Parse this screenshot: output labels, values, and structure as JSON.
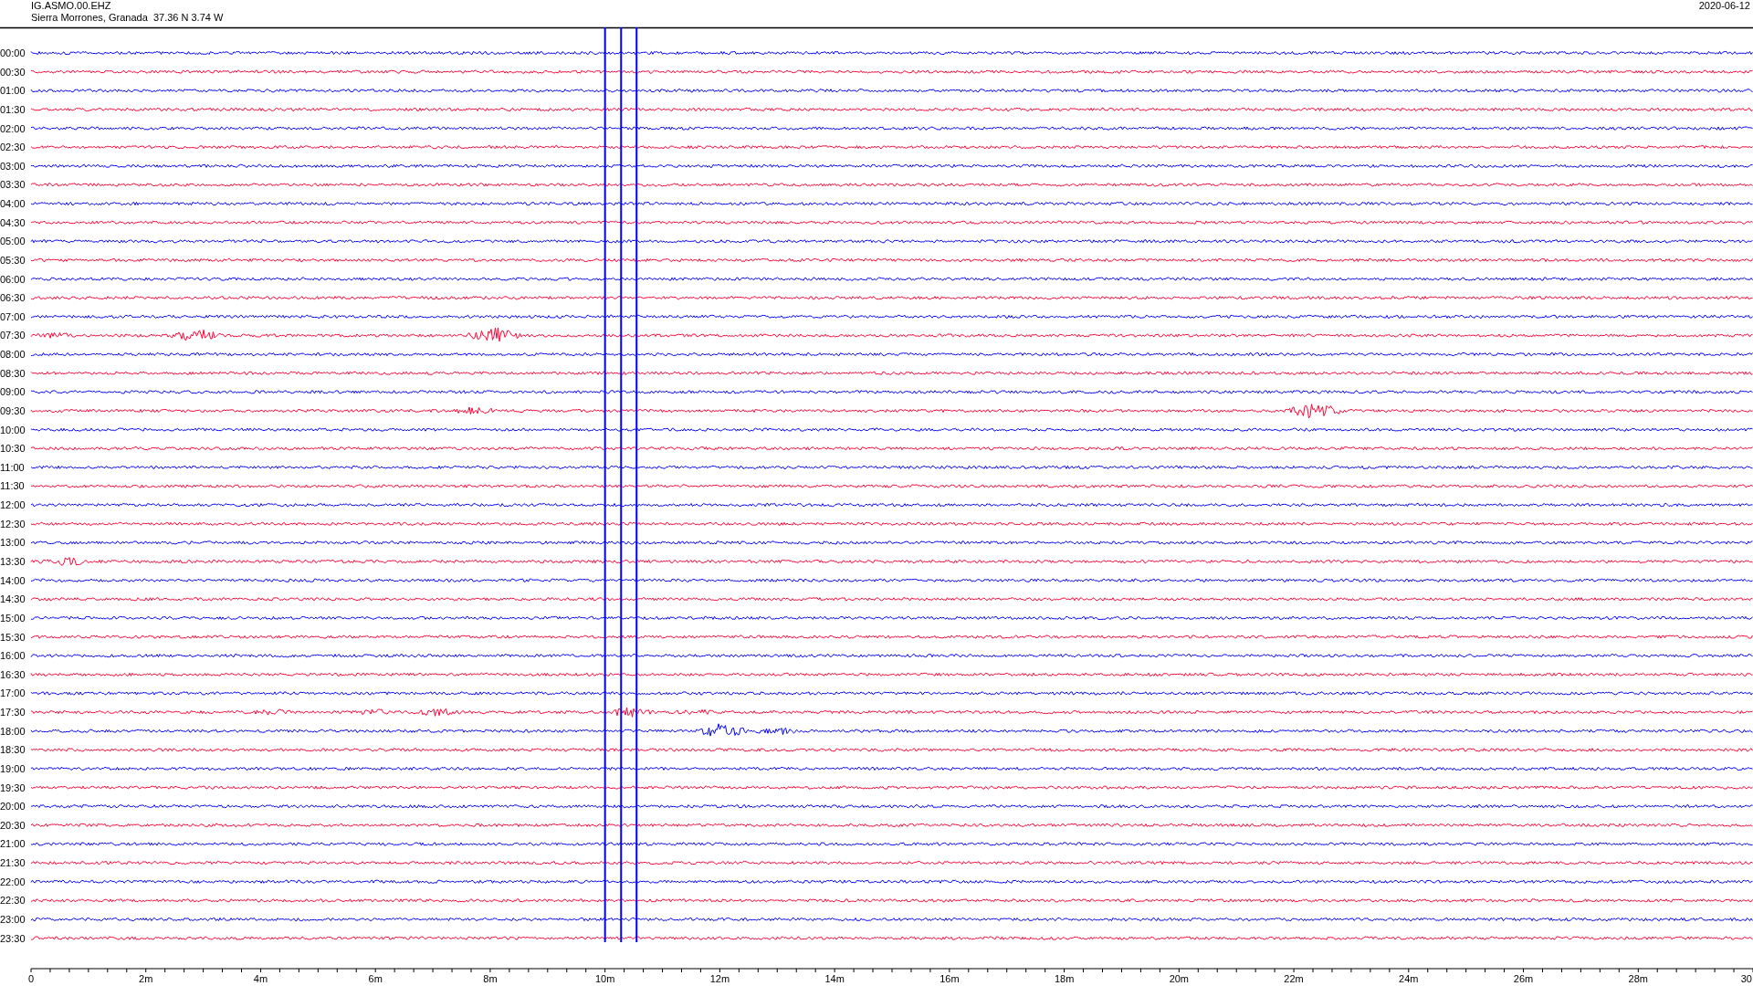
{
  "header": {
    "station": "IG.ASMO.00.EHZ",
    "location": "Sierra Morrones, Granada  37.36 N 3.74 W",
    "date": "2020-06-12"
  },
  "traces": [
    {
      "time": "00:00",
      "color": "#0000ff"
    },
    {
      "time": "00:30",
      "color": "#ff0033"
    },
    {
      "time": "01:00",
      "color": "#0000ff"
    },
    {
      "time": "01:30",
      "color": "#ff0033"
    },
    {
      "time": "02:00",
      "color": "#0000ff"
    },
    {
      "time": "02:30",
      "color": "#ff0033"
    },
    {
      "time": "03:00",
      "color": "#0000ff"
    },
    {
      "time": "03:30",
      "color": "#ff0033"
    },
    {
      "time": "04:00",
      "color": "#0000ff"
    },
    {
      "time": "04:30",
      "color": "#ff0033"
    },
    {
      "time": "05:00",
      "color": "#0000ff"
    },
    {
      "time": "05:30",
      "color": "#ff0033"
    },
    {
      "time": "06:00",
      "color": "#0000ff"
    },
    {
      "time": "06:30",
      "color": "#ff0033"
    },
    {
      "time": "07:00",
      "color": "#0000ff"
    },
    {
      "time": "07:30",
      "color": "#ff0033"
    },
    {
      "time": "08:00",
      "color": "#0000ff"
    },
    {
      "time": "08:30",
      "color": "#ff0033"
    },
    {
      "time": "09:00",
      "color": "#0000ff"
    },
    {
      "time": "09:30",
      "color": "#ff0033"
    },
    {
      "time": "10:00",
      "color": "#0000ff"
    },
    {
      "time": "10:30",
      "color": "#ff0033"
    },
    {
      "time": "11:00",
      "color": "#0000ff"
    },
    {
      "time": "11:30",
      "color": "#ff0033"
    },
    {
      "time": "12:00",
      "color": "#0000ff"
    },
    {
      "time": "12:30",
      "color": "#ff0033"
    },
    {
      "time": "13:00",
      "color": "#0000ff"
    },
    {
      "time": "13:30",
      "color": "#ff0033"
    },
    {
      "time": "14:00",
      "color": "#0000ff"
    },
    {
      "time": "14:30",
      "color": "#ff0033"
    },
    {
      "time": "15:00",
      "color": "#0000ff"
    },
    {
      "time": "15:30",
      "color": "#ff0033"
    },
    {
      "time": "16:00",
      "color": "#0000ff"
    },
    {
      "time": "16:30",
      "color": "#ff0033"
    },
    {
      "time": "17:00",
      "color": "#0000ff"
    },
    {
      "time": "17:30",
      "color": "#ff0033"
    },
    {
      "time": "18:00",
      "color": "#0000ff"
    },
    {
      "time": "18:30",
      "color": "#ff0033"
    },
    {
      "time": "19:00",
      "color": "#0000ff"
    },
    {
      "time": "19:30",
      "color": "#ff0033"
    },
    {
      "time": "20:00",
      "color": "#0000ff"
    },
    {
      "time": "20:30",
      "color": "#ff0033"
    },
    {
      "time": "21:00",
      "color": "#0000ff"
    },
    {
      "time": "21:30",
      "color": "#ff0033"
    },
    {
      "time": "22:00",
      "color": "#0000ff"
    },
    {
      "time": "22:30",
      "color": "#ff0033"
    },
    {
      "time": "23:00",
      "color": "#0000ff"
    },
    {
      "time": "23:30",
      "color": "#ff0033"
    }
  ],
  "x_axis": {
    "labels": [
      "0",
      "2m",
      "4m",
      "6m",
      "8m",
      "10m",
      "12m",
      "14m",
      "16m",
      "18m",
      "20m",
      "22m",
      "24m",
      "26m",
      "28m",
      "30"
    ]
  }
}
